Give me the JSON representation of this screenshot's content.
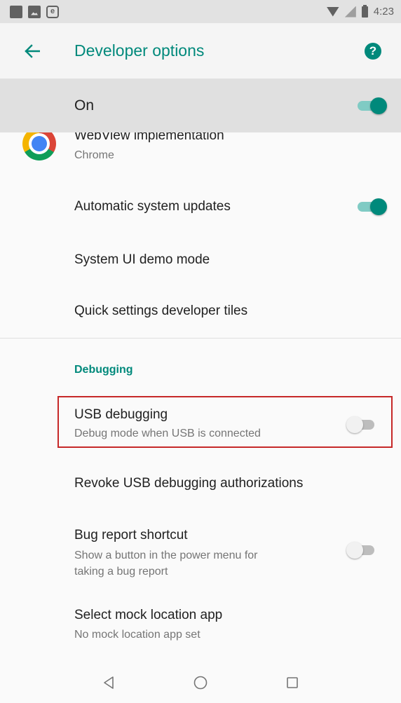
{
  "status_bar": {
    "time": "4:23",
    "icons": [
      "notification-square-icon",
      "image-icon",
      "e-badge-icon",
      "wifi-icon",
      "signal-icon",
      "battery-icon"
    ]
  },
  "app_bar": {
    "title": "Developer options",
    "back_icon": "arrow-back-icon",
    "help_icon": "help-icon",
    "help_glyph": "?"
  },
  "master_switch": {
    "label": "On",
    "checked": true
  },
  "settings": [
    {
      "title": "WebView implementation",
      "subtitle": "Chrome",
      "icon": "chrome-icon"
    },
    {
      "title": "Automatic system updates",
      "toggle": true
    },
    {
      "title": "System UI demo mode"
    },
    {
      "title": "Quick settings developer tiles"
    }
  ],
  "debugging": {
    "header": "Debugging",
    "items": [
      {
        "title": "USB debugging",
        "subtitle": "Debug mode when USB is connected",
        "toggle": false,
        "highlighted": true
      },
      {
        "title": "Revoke USB debugging authorizations"
      },
      {
        "title": "Bug report shortcut",
        "subtitle_line1": "Show a button in the power menu for",
        "subtitle_line2": "taking a bug report",
        "toggle": false
      },
      {
        "title": "Select mock location app",
        "subtitle": "No mock location app set"
      }
    ]
  },
  "nav_bar": {
    "buttons": [
      "back-triangle-icon",
      "home-circle-icon",
      "recents-square-icon"
    ]
  },
  "colors": {
    "accent": "#00897b",
    "highlight_border": "#c62828"
  }
}
